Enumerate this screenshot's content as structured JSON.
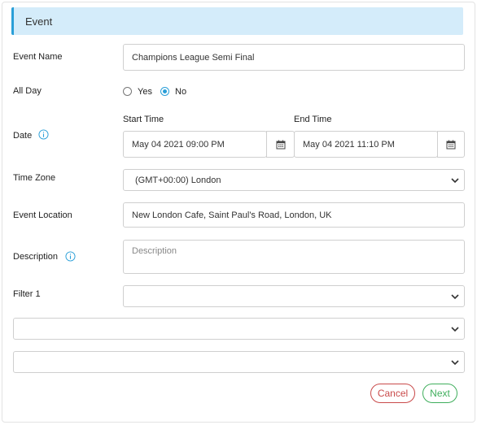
{
  "section": {
    "title": "Event"
  },
  "fields": {
    "event_name": {
      "label": "Event Name",
      "value": "Champions League Semi Final"
    },
    "all_day": {
      "label": "All Day",
      "options": [
        "Yes",
        "No"
      ],
      "selected": "No"
    },
    "date": {
      "label": "Date",
      "start_label": "Start Time",
      "start_value": "May 04 2021 09:00 PM",
      "end_label": "End Time",
      "end_value": "May 04 2021 11:10 PM"
    },
    "time_zone": {
      "label": "Time Zone",
      "value": "(GMT+00:00) London"
    },
    "event_location": {
      "label": "Event Location",
      "value": "New London Cafe, Saint Paul's Road, London, UK"
    },
    "description": {
      "label": "Description",
      "placeholder": "Description",
      "value": ""
    },
    "filter_1": {
      "label": "Filter 1",
      "value": ""
    },
    "extra_select_1": {
      "value": ""
    },
    "extra_select_2": {
      "value": ""
    }
  },
  "buttons": {
    "cancel": "Cancel",
    "next": "Next"
  },
  "icons": {
    "info": "info-circle-icon",
    "calendar": "calendar-icon",
    "dropdown": "chevron-down-icon"
  },
  "colors": {
    "header_bg": "#d4ecfa",
    "accent": "#2a9fd8",
    "cancel": "#c94a4a",
    "next": "#3fae5c"
  }
}
